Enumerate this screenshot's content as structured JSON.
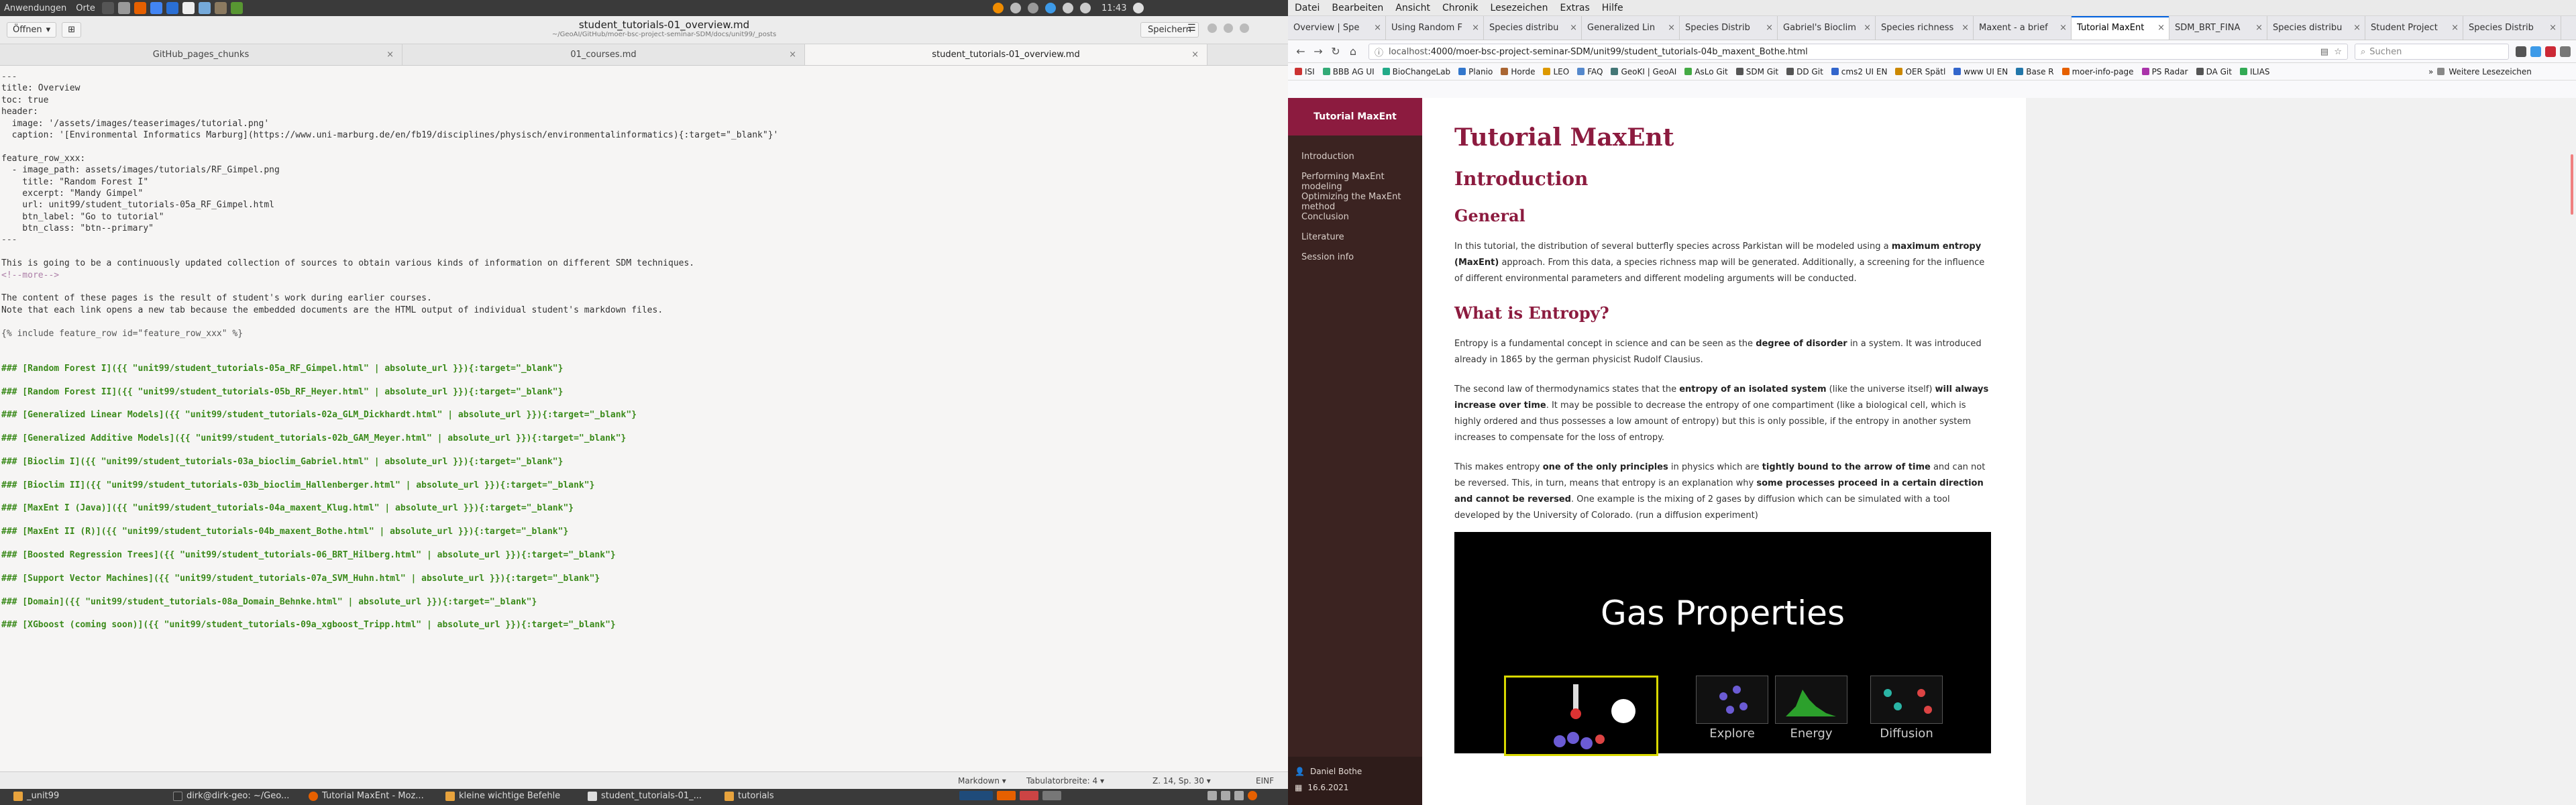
{
  "system_top": {
    "menu": [
      "Anwendungen",
      "Orte"
    ],
    "clock": "11:43"
  },
  "editor": {
    "open_label": "Öffnen",
    "title": "student_tutorials-01_overview.md",
    "subtitle": "~/GeoAI/GitHub/moer-bsc-project-seminar-SDM/docs/unit99/_posts",
    "save_label": "Speichern",
    "tabs": [
      {
        "label": "GitHub_pages_chunks",
        "active": false
      },
      {
        "label": "01_courses.md",
        "active": false
      },
      {
        "label": "student_tutorials-01_overview.md",
        "active": true
      }
    ],
    "lines": [
      {
        "t": "---",
        "c": "c-gray"
      },
      {
        "t": "title: Overview",
        "c": "c-key"
      },
      {
        "t": "toc: true",
        "c": "c-key"
      },
      {
        "t": "header:",
        "c": "c-key"
      },
      {
        "t": "  image: '/assets/images/teaserimages/tutorial.png'",
        "c": "c-key"
      },
      {
        "t": "  caption: '[Environmental Informatics Marburg](https://www.uni-marburg.de/en/fb19/disciplines/physisch/environmentalinformatics){:target=\"_blank\"}'",
        "c": "c-key"
      },
      {
        "t": "",
        "c": ""
      },
      {
        "t": "feature_row_xxx:",
        "c": "c-key"
      },
      {
        "t": "  - image_path: assets/images/tutorials/RF_Gimpel.png",
        "c": "c-key"
      },
      {
        "t": "    title: \"Random Forest I\"",
        "c": "c-key"
      },
      {
        "t": "    excerpt: \"Mandy Gimpel\"",
        "c": "c-key"
      },
      {
        "t": "    url: unit99/student_tutorials-05a_RF_Gimpel.html",
        "c": "c-key"
      },
      {
        "t": "    btn_label: \"Go to tutorial\"",
        "c": "c-key"
      },
      {
        "t": "    btn_class: \"btn--primary\"",
        "c": "c-key"
      },
      {
        "t": "---",
        "c": "c-gray"
      },
      {
        "t": "",
        "c": ""
      },
      {
        "t": "This is going to be a continuously updated collection of sources to obtain various kinds of information on different SDM techniques.",
        "c": "c-key"
      },
      {
        "t": "<!--more-->",
        "c": "c-comment"
      },
      {
        "t": "",
        "c": ""
      },
      {
        "t": "The content of these pages is the result of student's work during earlier courses.",
        "c": "c-key"
      },
      {
        "t": "Note that each link opens a new tab because the embedded documents are the HTML output of individual student's markdown files.",
        "c": "c-key"
      },
      {
        "t": "",
        "c": ""
      },
      {
        "t": "{% include feature_row id=\"feature_row_xxx\" %}",
        "c": "c-gray"
      },
      {
        "t": "",
        "c": ""
      },
      {
        "t": "",
        "c": ""
      },
      {
        "t": "### [Random Forest I]({{ \"unit99/student_tutorials-05a_RF_Gimpel.html\" | absolute_url }}){:target=\"_blank\"}",
        "c": "c-green"
      },
      {
        "t": "",
        "c": ""
      },
      {
        "t": "### [Random Forest II]({{ \"unit99/student_tutorials-05b_RF_Heyer.html\" | absolute_url }}){:target=\"_blank\"}",
        "c": "c-green"
      },
      {
        "t": "",
        "c": ""
      },
      {
        "t": "### [Generalized Linear Models]({{ \"unit99/student_tutorials-02a_GLM_Dickhardt.html\" | absolute_url }}){:target=\"_blank\"}",
        "c": "c-green"
      },
      {
        "t": "",
        "c": ""
      },
      {
        "t": "### [Generalized Additive Models]({{ \"unit99/student_tutorials-02b_GAM_Meyer.html\" | absolute_url }}){:target=\"_blank\"}",
        "c": "c-green"
      },
      {
        "t": "",
        "c": ""
      },
      {
        "t": "### [Bioclim I]({{ \"unit99/student_tutorials-03a_bioclim_Gabriel.html\" | absolute_url }}){:target=\"_blank\"}",
        "c": "c-green"
      },
      {
        "t": "",
        "c": ""
      },
      {
        "t": "### [Bioclim II]({{ \"unit99/student_tutorials-03b_bioclim_Hallenberger.html\" | absolute_url }}){:target=\"_blank\"}",
        "c": "c-green"
      },
      {
        "t": "",
        "c": ""
      },
      {
        "t": "### [MaxEnt I (Java)]({{ \"unit99/student_tutorials-04a_maxent_Klug.html\" | absolute_url }}){:target=\"_blank\"}",
        "c": "c-green"
      },
      {
        "t": "",
        "c": ""
      },
      {
        "t": "### [MaxEnt II (R)]({{ \"unit99/student_tutorials-04b_maxent_Bothe.html\" | absolute_url }}){:target=\"_blank\"}",
        "c": "c-green"
      },
      {
        "t": "",
        "c": ""
      },
      {
        "t": "### [Boosted Regression Trees]({{ \"unit99/student_tutorials-06_BRT_Hilberg.html\" | absolute_url }}){:target=\"_blank\"}",
        "c": "c-green"
      },
      {
        "t": "",
        "c": ""
      },
      {
        "t": "### [Support Vector Machines]({{ \"unit99/student_tutorials-07a_SVM_Huhn.html\" | absolute_url }}){:target=\"_blank\"}",
        "c": "c-green"
      },
      {
        "t": "",
        "c": ""
      },
      {
        "t": "### [Domain]({{ \"unit99/student_tutorials-08a_Domain_Behnke.html\" | absolute_url }}){:target=\"_blank\"}",
        "c": "c-green"
      },
      {
        "t": "",
        "c": ""
      },
      {
        "t": "### [XGboost (coming soon)]({{ \"unit99/student_tutorials-09a_xgboost_Tripp.html\" | absolute_url }}){:target=\"_blank\"}",
        "c": "c-green"
      }
    ],
    "status": {
      "language": "Markdown",
      "tab_width": "Tabulatorbreite: 4",
      "position": "Z. 14, Sp. 30",
      "mode": "EINF"
    }
  },
  "taskbar": {
    "items": [
      "_unit99",
      "dirk@dirk-geo: ~/Geo...",
      "Tutorial MaxEnt - Moz...",
      "kleine wichtige Befehle",
      "student_tutorials-01_...",
      "tutorials"
    ]
  },
  "browser": {
    "menu": [
      "Datei",
      "Bearbeiten",
      "Ansicht",
      "Chronik",
      "Lesezeichen",
      "Extras",
      "Hilfe"
    ],
    "tabs": [
      {
        "label": "Overview | Spe",
        "active": false
      },
      {
        "label": "Using Random F",
        "active": false
      },
      {
        "label": "Species distribu",
        "active": false
      },
      {
        "label": "Generalized Lin",
        "active": false
      },
      {
        "label": "Species Distrib",
        "active": false
      },
      {
        "label": "Gabriel's Bioclim",
        "active": false
      },
      {
        "label": "Species richness",
        "active": false
      },
      {
        "label": "Maxent - a brief",
        "active": false
      },
      {
        "label": "Tutorial MaxEnt",
        "active": true
      },
      {
        "label": "SDM_BRT_FINA",
        "active": false
      },
      {
        "label": "Species distribu",
        "active": false
      },
      {
        "label": "Student Project",
        "active": false
      },
      {
        "label": "Species Distrib",
        "active": false
      }
    ],
    "url_host": "localhost",
    "url_rest": ":4000/moer-bsc-project-seminar-SDM/unit99/student_tutorials-04b_maxent_Bothe.html",
    "search_placeholder": "Suchen",
    "bookmarks": [
      "ISI",
      "BBB AG UI",
      "BioChangeLab",
      "Planio",
      "Horde",
      "LEO",
      "FAQ",
      "GeoKI | GeoAI",
      "AsLo Git",
      "SDM Git",
      "DD Git",
      "cms2 UI EN",
      "OER Spätl",
      "www UI EN",
      "Base R",
      "moer-info-page",
      "PS Radar",
      "DA Git",
      "ILIAS"
    ],
    "bookmarks_more": "Weitere Lesezeichen"
  },
  "page": {
    "sidebar_title": "Tutorial MaxEnt",
    "toc": [
      "Introduction",
      "Performing MaxEnt modeling",
      "Optimizing the MaxEnt method",
      "Conclusion",
      "Literature",
      "Session info"
    ],
    "author": "Daniel Bothe",
    "date": "16.6.2021",
    "title": "Tutorial MaxEnt",
    "h_intro": "Introduction",
    "h_general": "General",
    "p_general_1": "In this tutorial, the distribution of several butterfly species across Parkistan will be modeled using a ",
    "p_general_b1": "maximum entropy (MaxEnt)",
    "p_general_2": " approach. From this data, a species richness map will be generated. Additionally, a screening for the influence of different environmental parameters and different modeling arguments will be conducted.",
    "h_entropy": "What is Entropy?",
    "p_e1_1": "Entropy is a fundamental concept in science and can be seen as the ",
    "p_e1_b": "degree of disorder",
    "p_e1_2": " in a system. It was introduced already in 1865 by the german physicist Rudolf Clausius.",
    "p_e2_1": "The second law of thermodynamics states that the ",
    "p_e2_b1": "entropy of an isolated system",
    "p_e2_2": " (like the universe itself) ",
    "p_e2_b2": "will always increase over time",
    "p_e2_3": ". It may be possible to decrease the entropy of one compartiment (like a biological cell, which is highly ordered and thus possesses a low amount of entropy) but this is only possible, if the entropy in another system increases to compensate for the loss of entropy.",
    "p_e3_1": "This makes entropy ",
    "p_e3_b1": "one of the only principles",
    "p_e3_2": " in physics which are ",
    "p_e3_b2": "tightly bound to the arrow of time",
    "p_e3_3": " and can not be reversed. This, in turn, means that entropy is an explanation why ",
    "p_e3_b3": "some processes proceed in a certain direction and cannot be reversed",
    "p_e3_4": ". One example is the mixing of 2 gases by diffusion which can be simulated with a tool developed by the University of Colorado. (run a diffusion experiment)",
    "gas_title": "Gas Properties",
    "gas_labels": [
      "Explore",
      "Energy",
      "Diffusion"
    ]
  }
}
